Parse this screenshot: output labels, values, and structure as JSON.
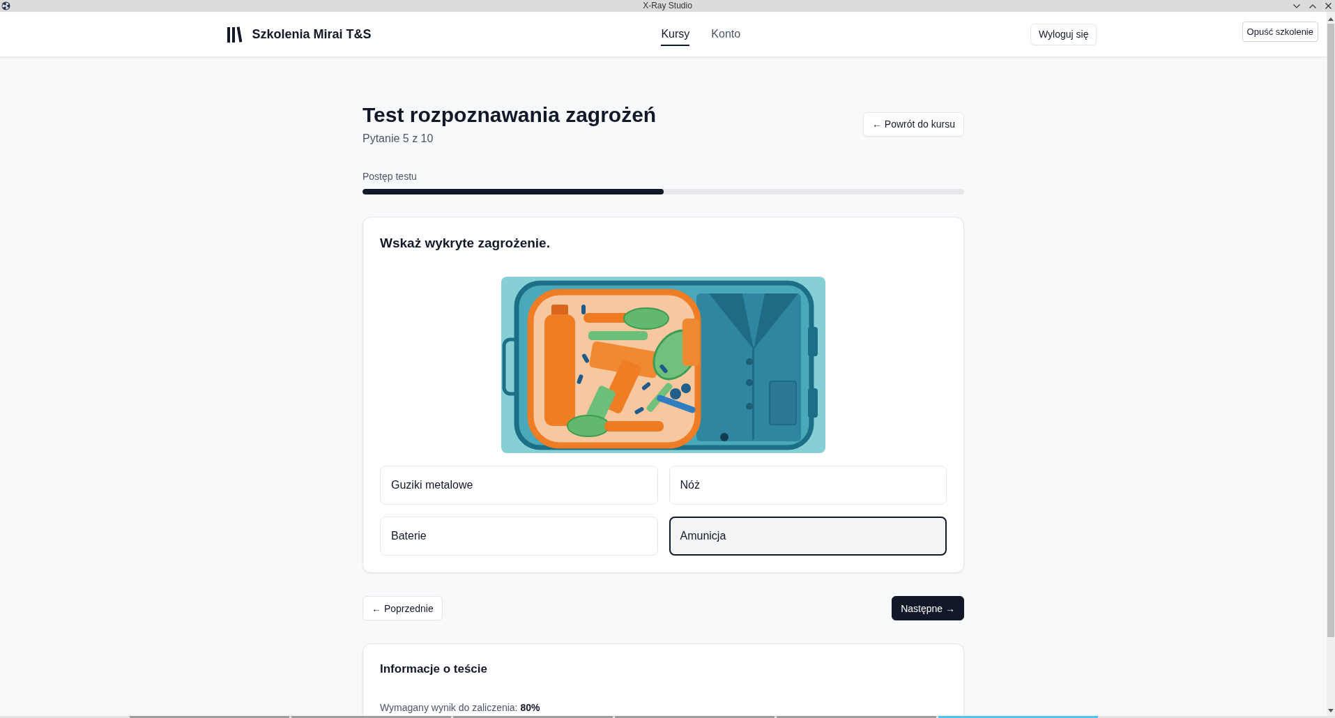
{
  "window": {
    "title": "X-Ray Studio"
  },
  "header": {
    "brand": "Szkolenia Mirai T&S",
    "nav": [
      {
        "label": "Kursy",
        "selected": true
      },
      {
        "label": "Konto",
        "selected": false
      }
    ],
    "logout_button": "Wyloguj się",
    "exit_button": "Opuść szkolenie"
  },
  "test": {
    "title": "Test rozpoznawania zagrożeń",
    "subtitle": "Pytanie 5 z 10",
    "back_button": "← Powrót do kursu",
    "progress": {
      "label": "Postęp testu",
      "level": 0.5
    }
  },
  "question": {
    "prompt": "Wskaż wykryte zagrożenie.",
    "answers": [
      {
        "label": "Guziki metalowe",
        "selected": false
      },
      {
        "label": "Nóż",
        "selected": false
      },
      {
        "label": "Baterie",
        "selected": false
      },
      {
        "label": "Amunicja",
        "selected": true
      }
    ]
  },
  "navigation": {
    "previous_button": "← Poprzednie",
    "next_button": "Następne →"
  },
  "info": {
    "title": "Informacje o teście",
    "lines": [
      "Wymagany wynik do zaliczenia: **80%**"
    ]
  },
  "taskbar": {
    "items": [
      {
        "selected": false
      },
      {
        "selected": false
      },
      {
        "selected": false
      },
      {
        "selected": false
      },
      {
        "selected": false
      },
      {
        "selected": true
      }
    ]
  }
}
